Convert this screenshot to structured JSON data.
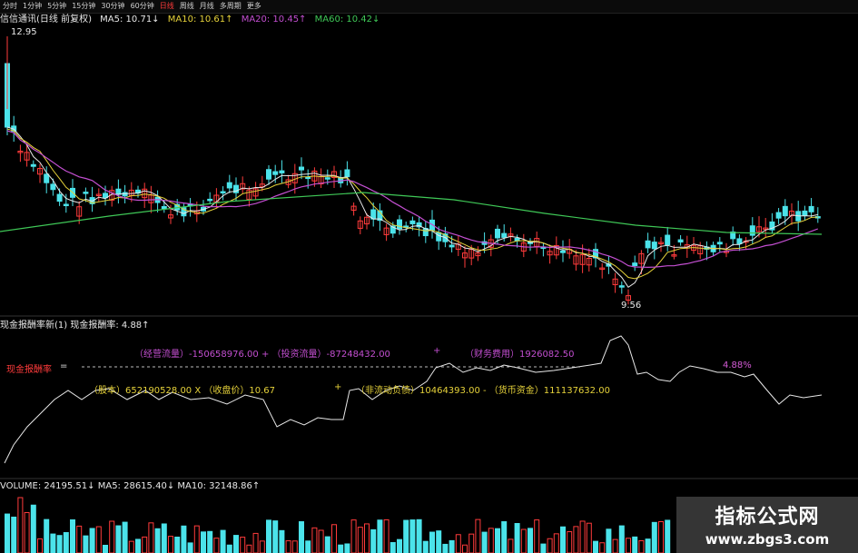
{
  "toolbar": {
    "items": [
      "分时",
      "1分钟",
      "5分钟",
      "15分钟",
      "30分钟",
      "60分钟",
      "日线",
      "周线",
      "月线",
      "多周期",
      "更多"
    ],
    "active_index": 6
  },
  "price_panel": {
    "title": "信信通讯(日线 前复权)",
    "ma5": "MA5: 10.71↓",
    "ma10": "MA10: 10.61↑",
    "ma20": "MA20: 10.45↑",
    "ma60": "MA60: 10.42↓",
    "high_label": "12.95",
    "low_label": "9.56"
  },
  "indicator_panel": {
    "header_name": "现金报酬率新(1)",
    "header_value": "现金报酬率: 4.88↑",
    "row_label": "现金报酬率",
    "equals": "=",
    "numerator": "（经营流量）-150658976.00 + （投资流量）-87248432.00",
    "numerator_plus": "+",
    "numerator_extra": "（财务费用）1926082.50",
    "denominator_a": "（股本）652190528.00 X （收盘价）10.67",
    "denominator_plus": "+",
    "denominator_b": "（非流动负债）10464393.00 - （货币资金）111137632.00",
    "current_value": "4.88%"
  },
  "volume_panel": {
    "label": "VOLUME: 24195.51↓",
    "ma5": "MA5: 28615.40↓",
    "ma10": "MA10: 32148.86↑"
  },
  "watermark": {
    "title": "指标公式网",
    "url": "www.zbgs3.com"
  },
  "colors": {
    "up": "#ff3b3b",
    "down": "#4be3ea",
    "ma5": "#e8e8e8",
    "ma10": "#e6d23a",
    "ma20": "#c34fd1",
    "ma60": "#3fc857",
    "indicator_line": "#e8e8e8"
  }
}
